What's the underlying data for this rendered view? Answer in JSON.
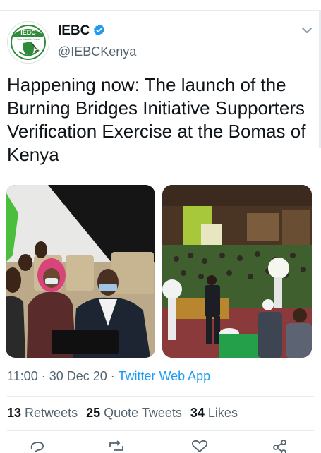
{
  "author": {
    "display_name": "IEBC",
    "handle": "@IEBCKenya",
    "avatar_logo_text": "IEBC",
    "avatar_logo_subtext": "Your Vote Your Voice",
    "verified_icon": "verified-badge-icon"
  },
  "tweet": {
    "text": "Happening now: The launch of the Burning Bridges Initiative Supporters Verification Exercise at the Bomas of Kenya"
  },
  "meta": {
    "time": "11:00",
    "separator": " · ",
    "date": "30 Dec 20",
    "app": "Twitter Web App"
  },
  "stats": {
    "retweets_count": "13",
    "retweets_label": "Retweets",
    "quotes_count": "25",
    "quotes_label": "Quote Tweets",
    "likes_count": "34",
    "likes_label": "Likes"
  },
  "actions": {
    "reply_icon": "reply-icon",
    "retweet_icon": "retweet-icon",
    "like_icon": "heart-icon",
    "share_icon": "share-icon"
  },
  "colors": {
    "link": "#1d9bf0",
    "muted": "#536471",
    "text": "#0f1419"
  }
}
